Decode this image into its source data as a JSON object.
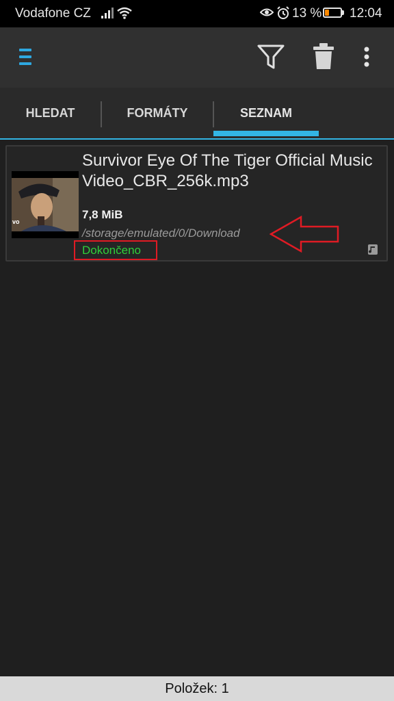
{
  "status_bar": {
    "carrier": "Vodafone CZ",
    "battery_percent": "13 %",
    "time": "12:04",
    "icons": [
      "signal-icon",
      "wifi-icon",
      "eye-icon",
      "alarm-icon",
      "battery-icon"
    ],
    "battery_color": "#ff8a00"
  },
  "action_bar": {
    "icons": [
      "menu-icon",
      "filter-icon",
      "trash-icon",
      "overflow-menu-icon"
    ],
    "accent_color": "#2ea8e0"
  },
  "tabs": [
    {
      "label": "HLEDAT"
    },
    {
      "label": "FORMÁTY"
    },
    {
      "label": "SEZNAM",
      "selected": true
    }
  ],
  "download": {
    "title": "Survivor Eye Of The Tiger Official Music Video_CBR_256k.mp3",
    "size": "7,8 MiB",
    "path": "/storage/emulated/0/Download",
    "status": "Dokončeno",
    "status_color": "#2fcf3a",
    "thumbnail_label": "vo",
    "type_icon": "music-note-icon"
  },
  "annotation_color": "#e01b24",
  "footer": {
    "count": "Položek: 1"
  }
}
